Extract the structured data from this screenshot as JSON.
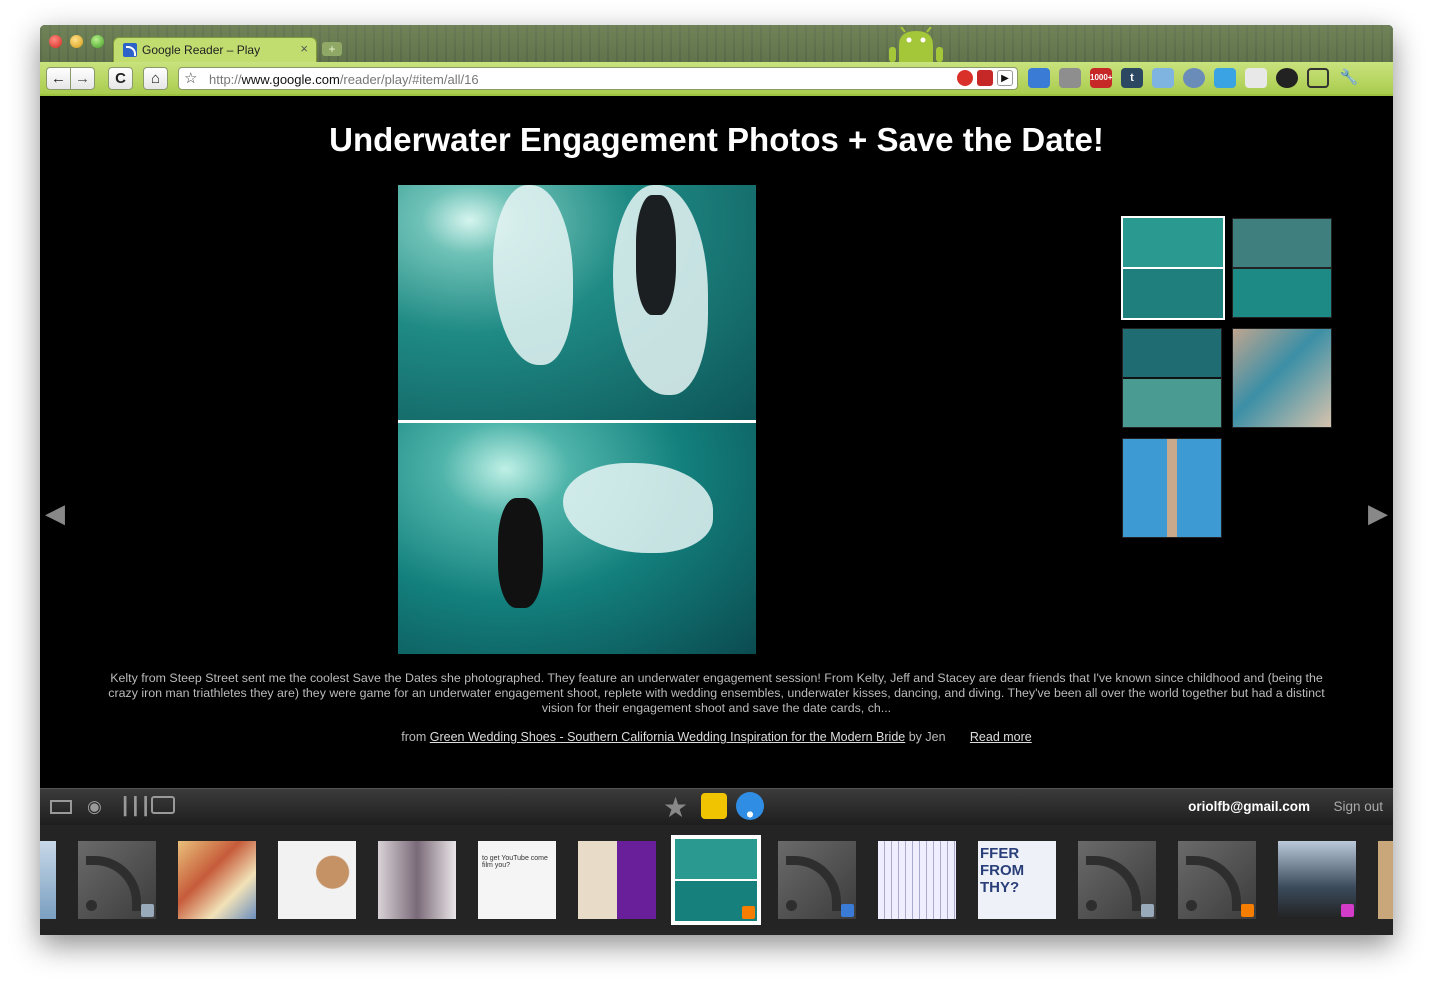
{
  "browser": {
    "tab_title": "Google Reader – Play",
    "tab_close": "×",
    "new_tab": "+",
    "url_scheme": "http://",
    "url_host": "www.google.com",
    "url_path": "/reader/play/#item/all/16",
    "back": "←",
    "forward": "→",
    "reload": "C",
    "home": "⌂",
    "star": "☆",
    "extensions": [
      "feeds-icon",
      "notification-icon",
      "counter-icon",
      "tumblr-icon",
      "bucket-icon",
      "globe-icon",
      "twitter-icon",
      "mail-icon",
      "settings-icon",
      "page-icon",
      "wrench-icon"
    ],
    "ext_badge": "1000+",
    "ext_t": "t"
  },
  "item": {
    "title": "Underwater Engagement Photos + Save the Date!",
    "description": "Kelty from Steep Street sent me the coolest Save the Dates she photographed. They feature an underwater engagement session! From Kelty, Jeff and Stacey are dear friends that I've known since childhood and (being the crazy iron man triathletes they are) they were game for an underwater engagement shoot, replete with wedding ensembles, underwater kisses, dancing, and diving. They've been all over the world together but had a distinct vision for their engagement shoot and save the date cards, ch...",
    "from_prefix": "from",
    "source": "Green Wedding Shoes - Southern California Wedding Inspiration for the Modern Bride",
    "by_author": "by Jen",
    "read_more": "Read more",
    "prev": "◀",
    "next": "▶"
  },
  "controls": {
    "user_email": "oriolfb@gmail.com",
    "sign_out": "Sign out",
    "left_icons": [
      "split-view-icon",
      "eye-icon",
      "chart-icon",
      "tv-icon"
    ],
    "center_icons": [
      "star-icon",
      "like-icon",
      "share-icon"
    ]
  },
  "filmstrip_text": {
    "f6_text": "to get YouTube come film you?",
    "f10_text": "FFER FROM THY?"
  },
  "colors": {
    "toolbar": "#b6d65d",
    "content_bg": "#000000",
    "accent": "#ffffff"
  }
}
